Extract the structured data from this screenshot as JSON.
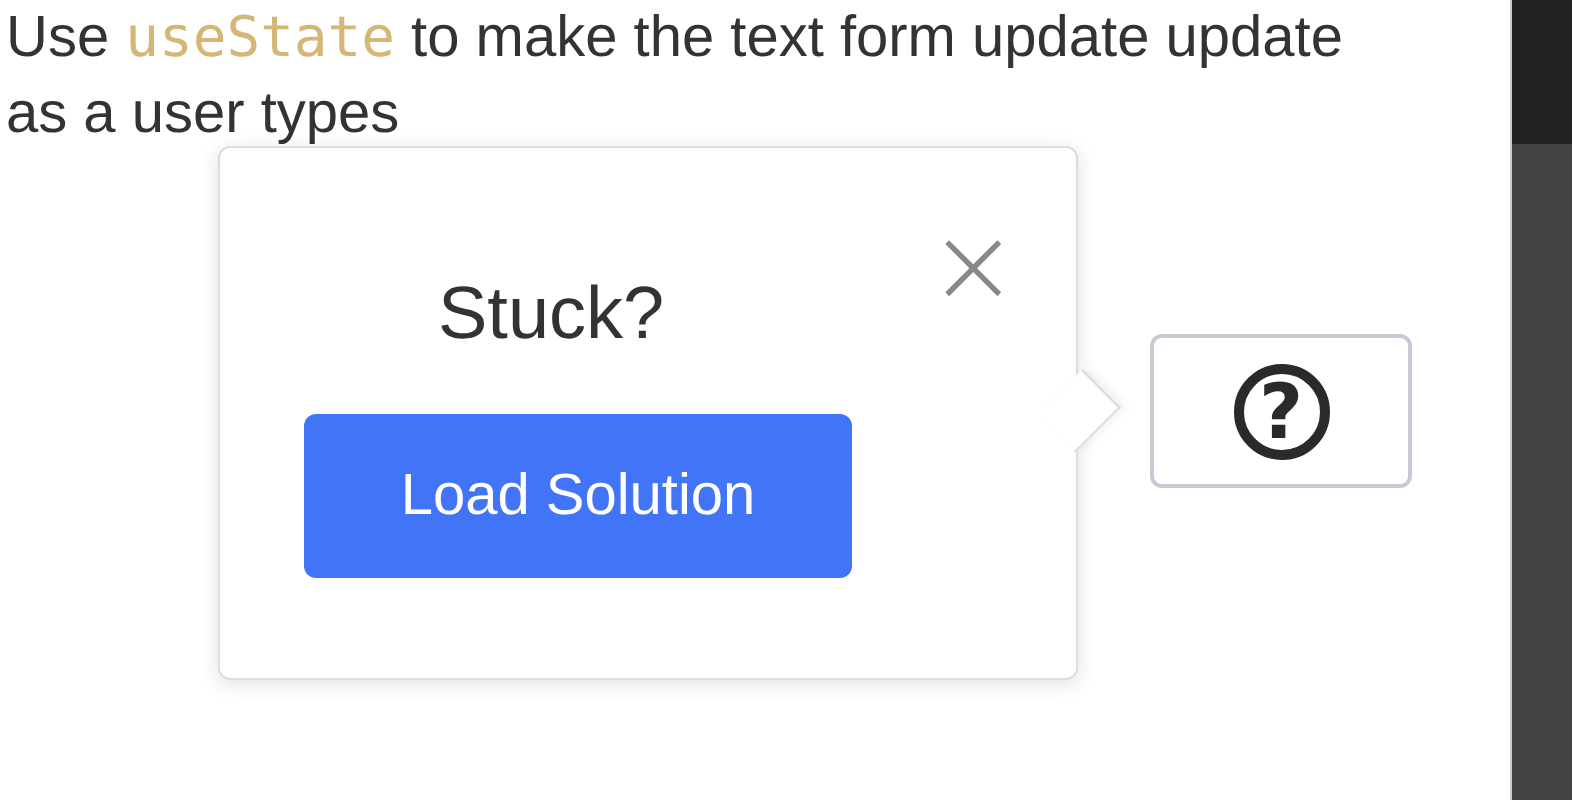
{
  "instructions": {
    "parts": [
      {
        "kind": "text",
        "text": "Use "
      },
      {
        "kind": "code",
        "text": "useState"
      },
      {
        "kind": "text",
        "text": " to make the text form update update as a user types"
      }
    ]
  },
  "popover": {
    "title": "Stuck?",
    "close": "×",
    "button": "Load Solution"
  },
  "help_button": {
    "label": "?"
  }
}
